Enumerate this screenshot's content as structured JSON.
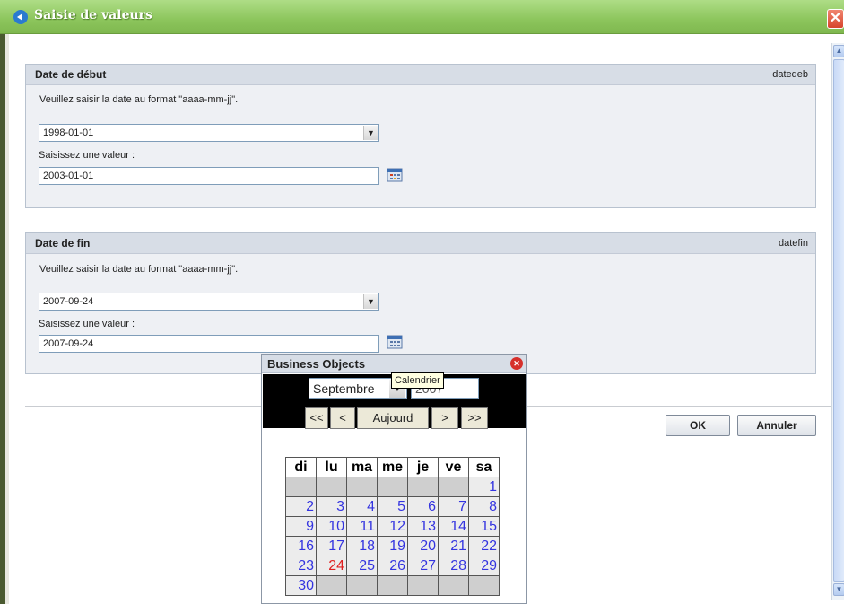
{
  "window": {
    "title": "Saisie de valeurs"
  },
  "panel_start": {
    "title": "Date de début",
    "key": "datedeb",
    "hint": "Veuillez saisir la date au format \"aaaa-mm-jj\".",
    "selected": "1998-01-01",
    "value_label": "Saisissez une valeur :",
    "value": "2003-01-01"
  },
  "panel_end": {
    "title": "Date de fin",
    "key": "datefin",
    "hint": "Veuillez saisir la date au format \"aaaa-mm-jj\".",
    "selected": "2007-09-24",
    "value_label": "Saisissez une valeur :",
    "value": "2007-09-24"
  },
  "buttons": {
    "ok": "OK",
    "cancel": "Annuler"
  },
  "calendar": {
    "title": "Business Objects",
    "month": "Septembre",
    "year": "2007",
    "tooltip": "Calendrier",
    "nav": {
      "first": "<<",
      "prev": "<",
      "today": "Aujourd",
      "next": ">",
      "last": ">>"
    },
    "weekdays": [
      "di",
      "lu",
      "ma",
      "me",
      "je",
      "ve",
      "sa"
    ],
    "weeks": [
      [
        "",
        "",
        "",
        "",
        "",
        "",
        "1"
      ],
      [
        "2",
        "3",
        "4",
        "5",
        "6",
        "7",
        "8"
      ],
      [
        "9",
        "10",
        "11",
        "12",
        "13",
        "14",
        "15"
      ],
      [
        "16",
        "17",
        "18",
        "19",
        "20",
        "21",
        "22"
      ],
      [
        "23",
        "24",
        "25",
        "26",
        "27",
        "28",
        "29"
      ],
      [
        "30",
        "",
        "",
        "",
        "",
        "",
        ""
      ]
    ],
    "highlighted_day": "24"
  },
  "colors": {
    "titlebar": "#8cc55c",
    "panel_head": "#d7dde6",
    "today": "#e02020",
    "days": "#3434e0"
  }
}
